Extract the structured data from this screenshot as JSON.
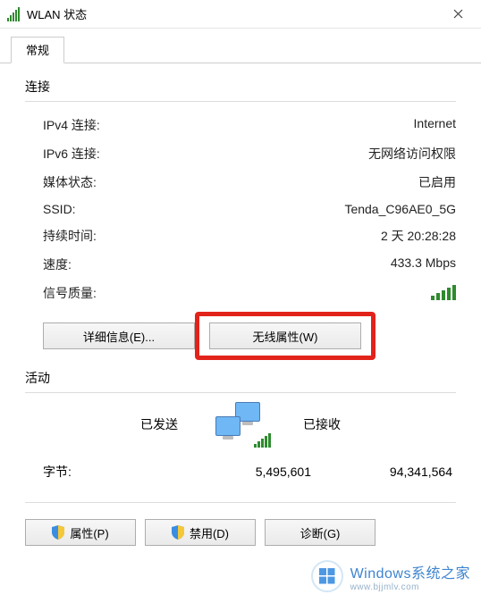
{
  "window": {
    "title": "WLAN 状态",
    "close_aria": "关闭"
  },
  "tabs": {
    "general": "常规"
  },
  "connection": {
    "section": "连接",
    "ipv4_label": "IPv4 连接:",
    "ipv4_value": "Internet",
    "ipv6_label": "IPv6 连接:",
    "ipv6_value": "无网络访问权限",
    "media_label": "媒体状态:",
    "media_value": "已启用",
    "ssid_label": "SSID:",
    "ssid_value": "Tenda_C96AE0_5G",
    "duration_label": "持续时间:",
    "duration_value": "2 天 20:28:28",
    "speed_label": "速度:",
    "speed_value": "433.3 Mbps",
    "signal_label": "信号质量:"
  },
  "buttons": {
    "details": "详细信息(E)...",
    "wireless_props": "无线属性(W)",
    "properties": "属性(P)",
    "disable": "禁用(D)",
    "diagnose": "诊断(G)"
  },
  "activity": {
    "section": "活动",
    "sent": "已发送",
    "received": "已接收",
    "bytes_label": "字节:",
    "bytes_sent": "5,495,601",
    "bytes_received": "94,341,564"
  },
  "watermark": {
    "line1_en": "Windows",
    "line1_cn": "系统之家",
    "line2": "www.bjjmlv.com"
  }
}
